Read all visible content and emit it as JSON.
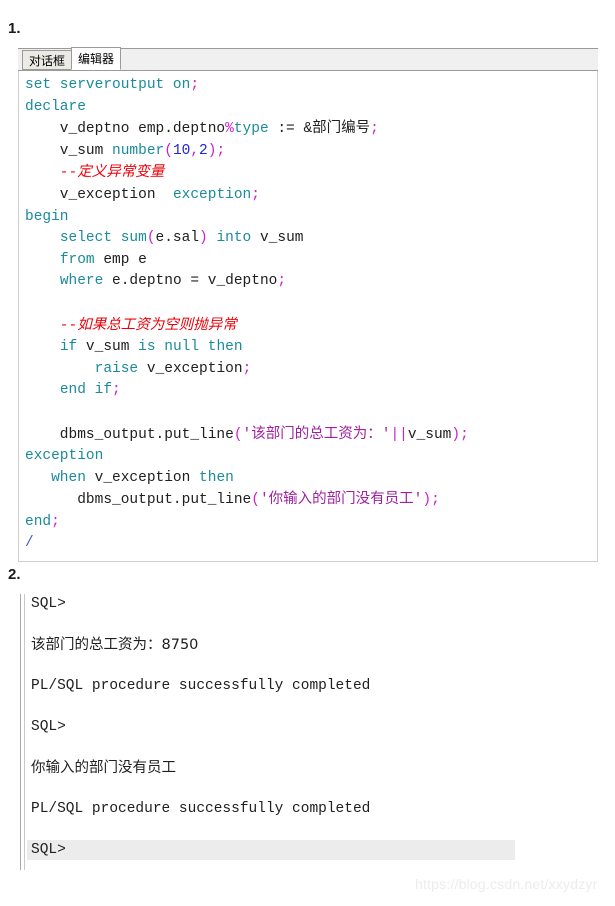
{
  "sections": {
    "first_label": "1.",
    "second_label": "2."
  },
  "editor": {
    "tabs": [
      {
        "label": "对话框",
        "active": false
      },
      {
        "label": "编辑器",
        "active": true
      }
    ],
    "code_lines": [
      [
        {
          "t": "set serveroutput on",
          "c": "kw"
        },
        {
          "t": ";",
          "c": "pn"
        }
      ],
      [
        {
          "t": "declare",
          "c": "kw"
        }
      ],
      [
        {
          "t": "    v_deptno emp.deptno",
          "c": "pl"
        },
        {
          "t": "%",
          "c": "pn"
        },
        {
          "t": "type",
          "c": "kw"
        },
        {
          "t": " := &",
          "c": "pl"
        },
        {
          "t": "部门编号",
          "c": "pl cjk"
        },
        {
          "t": ";",
          "c": "pn"
        }
      ],
      [
        {
          "t": "    v_sum ",
          "c": "pl"
        },
        {
          "t": "number",
          "c": "kw"
        },
        {
          "t": "(",
          "c": "pn"
        },
        {
          "t": "10",
          "c": "num"
        },
        {
          "t": ",",
          "c": "pn"
        },
        {
          "t": "2",
          "c": "num"
        },
        {
          "t": ")",
          "c": "pn"
        },
        {
          "t": ";",
          "c": "pn"
        }
      ],
      [
        {
          "t": "    --",
          "c": "cm"
        },
        {
          "t": "定义异常变量",
          "c": "cm cjk"
        }
      ],
      [
        {
          "t": "    v_exception  ",
          "c": "pl"
        },
        {
          "t": "exception",
          "c": "kw"
        },
        {
          "t": ";",
          "c": "pn"
        }
      ],
      [
        {
          "t": "begin",
          "c": "kw"
        }
      ],
      [
        {
          "t": "    ",
          "c": "pl"
        },
        {
          "t": "select sum",
          "c": "kw"
        },
        {
          "t": "(",
          "c": "pn"
        },
        {
          "t": "e.sal",
          "c": "pl"
        },
        {
          "t": ")",
          "c": "pn"
        },
        {
          "t": " ",
          "c": "pl"
        },
        {
          "t": "into",
          "c": "kw"
        },
        {
          "t": " v_sum",
          "c": "pl"
        }
      ],
      [
        {
          "t": "    ",
          "c": "pl"
        },
        {
          "t": "from",
          "c": "kw"
        },
        {
          "t": " emp e",
          "c": "pl"
        }
      ],
      [
        {
          "t": "    ",
          "c": "pl"
        },
        {
          "t": "where",
          "c": "kw"
        },
        {
          "t": " e.deptno = v_deptno",
          "c": "pl"
        },
        {
          "t": ";",
          "c": "pn"
        }
      ],
      [
        {
          "t": "",
          "c": "pl"
        }
      ],
      [
        {
          "t": "    --",
          "c": "cm"
        },
        {
          "t": "如果总工资为空则抛异常",
          "c": "cm cjk"
        }
      ],
      [
        {
          "t": "    ",
          "c": "pl"
        },
        {
          "t": "if",
          "c": "kw"
        },
        {
          "t": " v_sum ",
          "c": "pl"
        },
        {
          "t": "is null then",
          "c": "kw"
        }
      ],
      [
        {
          "t": "        ",
          "c": "pl"
        },
        {
          "t": "raise",
          "c": "kw"
        },
        {
          "t": " v_exception",
          "c": "pl"
        },
        {
          "t": ";",
          "c": "pn"
        }
      ],
      [
        {
          "t": "    ",
          "c": "pl"
        },
        {
          "t": "end if",
          "c": "kw"
        },
        {
          "t": ";",
          "c": "pn"
        }
      ],
      [
        {
          "t": "",
          "c": "pl"
        }
      ],
      [
        {
          "t": "    dbms_output.put_line",
          "c": "pl"
        },
        {
          "t": "(",
          "c": "pn"
        },
        {
          "t": "'",
          "c": "str"
        },
        {
          "t": "该部门的总工资为：",
          "c": "str cjk"
        },
        {
          "t": "'",
          "c": "str"
        },
        {
          "t": "||",
          "c": "pn"
        },
        {
          "t": "v_sum",
          "c": "pl"
        },
        {
          "t": ")",
          "c": "pn"
        },
        {
          "t": ";",
          "c": "pn"
        }
      ],
      [
        {
          "t": "exception",
          "c": "kw"
        }
      ],
      [
        {
          "t": "   ",
          "c": "pl"
        },
        {
          "t": "when",
          "c": "kw"
        },
        {
          "t": " v_exception ",
          "c": "pl"
        },
        {
          "t": "then",
          "c": "kw"
        }
      ],
      [
        {
          "t": "      dbms_output.put_line",
          "c": "pl"
        },
        {
          "t": "(",
          "c": "pn"
        },
        {
          "t": "'",
          "c": "str"
        },
        {
          "t": "你输入的部门没有员工",
          "c": "str cjk"
        },
        {
          "t": "'",
          "c": "str"
        },
        {
          "t": ")",
          "c": "pn"
        },
        {
          "t": ";",
          "c": "pn"
        }
      ],
      [
        {
          "t": "end",
          "c": "kw"
        },
        {
          "t": ";",
          "c": "pn"
        }
      ],
      [
        {
          "t": "/",
          "c": "sl"
        }
      ]
    ]
  },
  "console": {
    "lines": [
      {
        "text": "SQL>",
        "cjk": false,
        "highlighted": false
      },
      {
        "text": "该部门的总工资为：8750",
        "cjk": true,
        "highlighted": false
      },
      {
        "text": "PL/SQL procedure successfully completed",
        "cjk": false,
        "highlighted": false
      },
      {
        "text": "SQL>",
        "cjk": false,
        "highlighted": false
      },
      {
        "text": "你输入的部门没有员工",
        "cjk": true,
        "highlighted": false
      },
      {
        "text": "PL/SQL procedure successfully completed",
        "cjk": false,
        "highlighted": false
      },
      {
        "text": "SQL>",
        "cjk": false,
        "highlighted": true
      }
    ]
  },
  "watermark": {
    "text": "https://blog.csdn.net/xxydzyr"
  }
}
